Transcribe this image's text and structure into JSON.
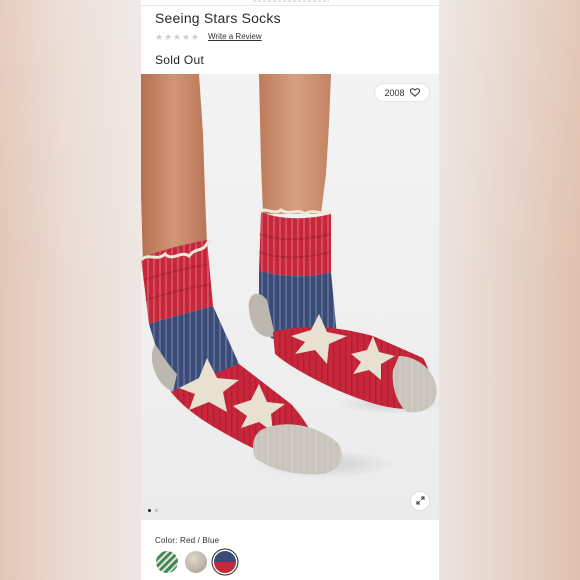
{
  "product": {
    "title": "Seeing Stars Socks",
    "rating_link": "Write a Review",
    "stock_status": "Sold Out"
  },
  "gallery": {
    "favorite_count": "2008",
    "icons": {
      "favorite": "heart-icon",
      "expand": "expand-icon"
    },
    "slide_count": 2,
    "active_slide": 1
  },
  "color": {
    "label": "Color: Red / Blue",
    "swatches": [
      {
        "name": "green-stripe",
        "colors": [
          "#3f8a5a",
          "#e9e2d3"
        ]
      },
      {
        "name": "oatmeal",
        "colors": [
          "#b9ad9e",
          "#dfd8cd"
        ]
      },
      {
        "name": "red-blue",
        "colors": [
          "#3b4b79",
          "#c8263b"
        ]
      }
    ],
    "selected": 2
  },
  "colors": {
    "sock_red": "#c8263b",
    "sock_navy": "#3b4b79",
    "sock_cream": "#e8e0d1",
    "sock_heel": "#bcb8b0",
    "skin": "#c98a67"
  }
}
